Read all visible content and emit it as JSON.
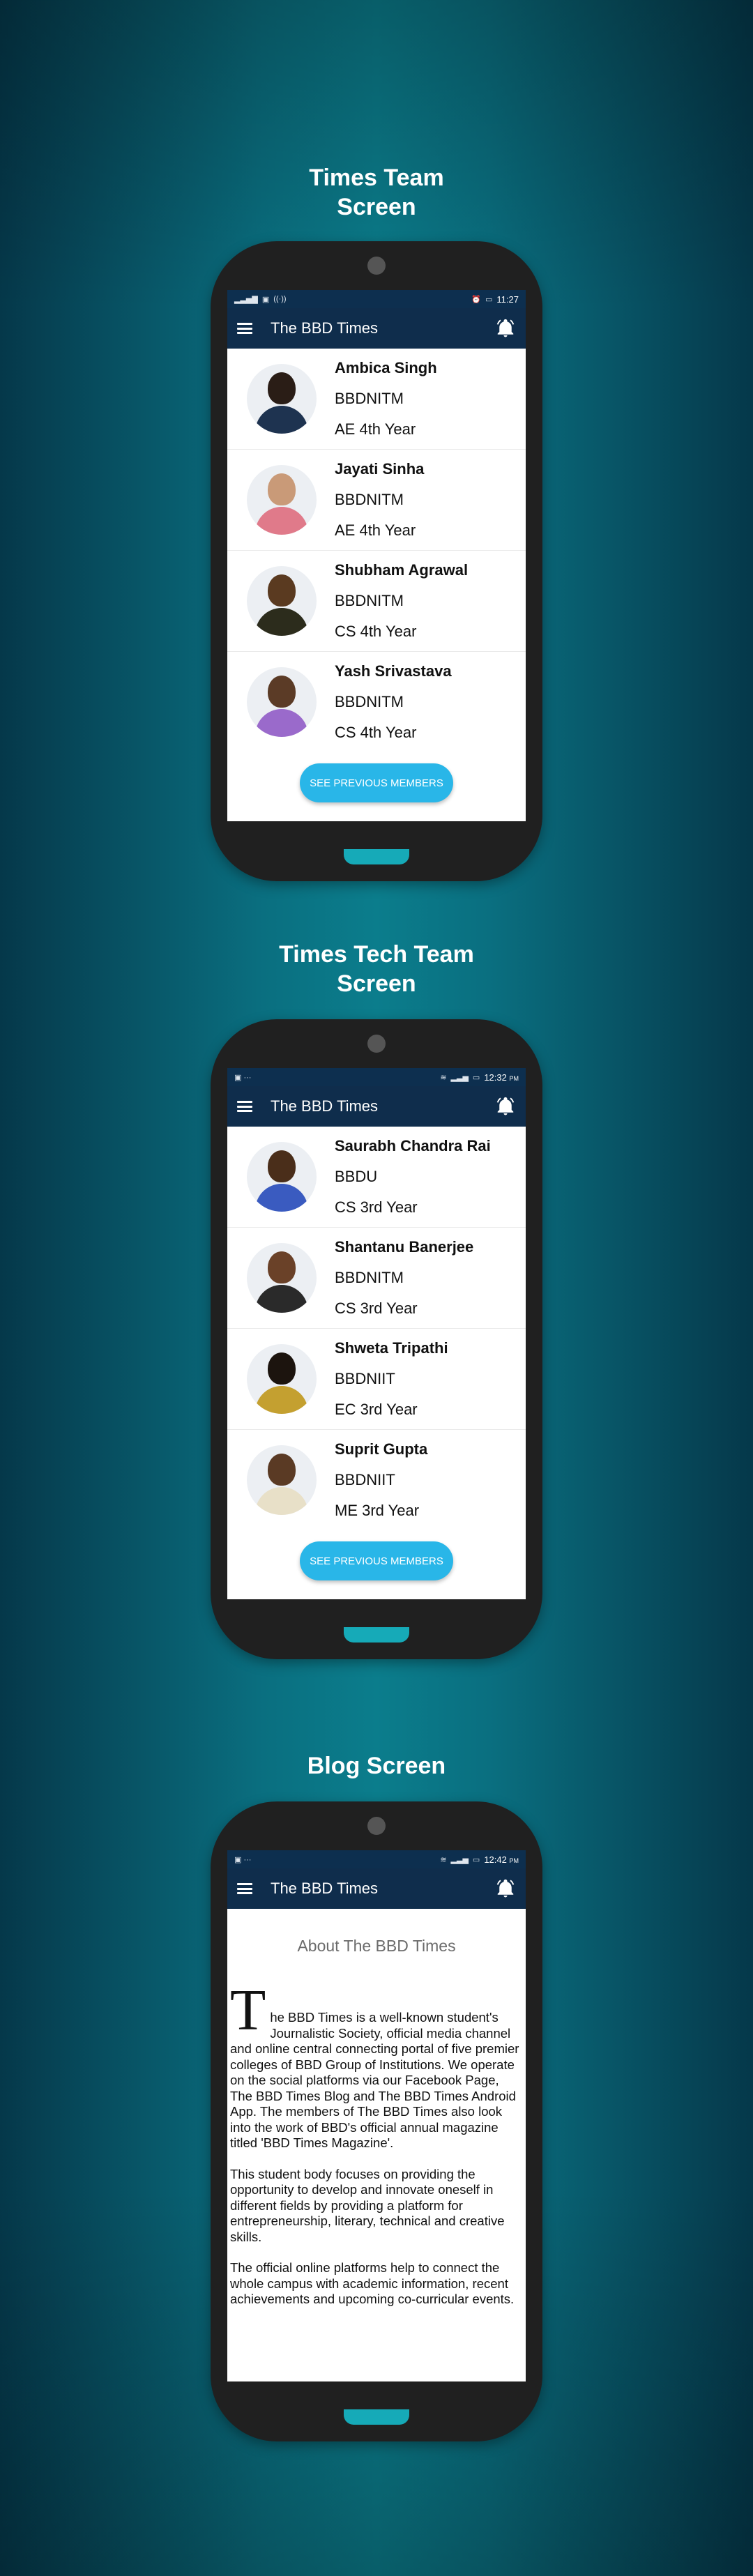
{
  "sections": [
    {
      "title_line1": "Times Team",
      "title_line2": "Screen",
      "status": {
        "time": "11:27"
      },
      "app_title": "The BBD Times",
      "members": [
        {
          "name": "Ambica Singh",
          "college": "BBDNITM",
          "year": "AE 4th Year"
        },
        {
          "name": "Jayati Sinha",
          "college": "BBDNITM",
          "year": "AE 4th Year"
        },
        {
          "name": "Shubham Agrawal",
          "college": "BBDNITM",
          "year": "CS 4th Year"
        },
        {
          "name": "Yash Srivastava",
          "college": "BBDNITM",
          "year": "CS 4th Year"
        }
      ],
      "button": "SEE PREVIOUS MEMBERS"
    },
    {
      "title_line1": "Times Tech Team",
      "title_line2": "Screen",
      "status": {
        "time": "12:32",
        "ampm": "PM"
      },
      "app_title": "The BBD Times",
      "members": [
        {
          "name": "Saurabh Chandra Rai",
          "college": "BBDU",
          "year": "CS 3rd Year"
        },
        {
          "name": "Shantanu Banerjee",
          "college": "BBDNITM",
          "year": "CS 3rd Year"
        },
        {
          "name": "Shweta Tripathi",
          "college": "BBDNIIT",
          "year": "EC 3rd Year"
        },
        {
          "name": "Suprit Gupta",
          "college": "BBDNIIT",
          "year": "ME 3rd Year"
        }
      ],
      "button": "SEE PREVIOUS MEMBERS"
    },
    {
      "title_line1": "Blog Screen",
      "status": {
        "time": "12:42",
        "ampm": "PM"
      },
      "app_title": "The BBD Times",
      "blog": {
        "heading": "About The BBD Times",
        "dropcap": "T",
        "para1": "he BBD Times is a well-known student's Journalistic Society, official media channel and online central connecting portal of five premier colleges of BBD Group of Institutions. We operate on the social platforms via our Facebook Page, The BBD Times Blog and The BBD Times Android App. The members of The BBD Times also look into the work of BBD's official annual magazine titled 'BBD Times Magazine'.",
        "para2": "This student body focuses on providing the opportunity to develop and innovate oneself in different fields by providing a platform for entrepreneurship, literary, technical and creative skills.",
        "para3": "The official online platforms help to connect the whole campus with academic information, recent achievements and upcoming co-curricular events."
      }
    }
  ],
  "colors": {
    "appbar": "#0f2d4c",
    "button": "#29b6e8",
    "home_button": "#16aab8"
  }
}
